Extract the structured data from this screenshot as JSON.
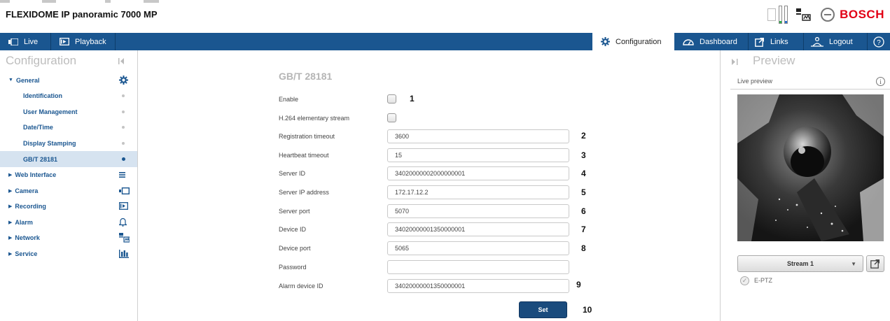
{
  "header": {
    "product_title": "FLEXIDOME IP panoramic 7000 MP",
    "brand": "BOSCH",
    "colors": {
      "brand_red": "#e20015",
      "nav_blue": "#1a5690"
    }
  },
  "nav": {
    "live": "Live",
    "playback": "Playback",
    "configuration": "Configuration",
    "dashboard": "Dashboard",
    "links": "Links",
    "logout": "Logout",
    "help_icon": "help-icon"
  },
  "sidebar": {
    "title": "Configuration",
    "general": {
      "label": "General",
      "items": [
        {
          "label": "Identification"
        },
        {
          "label": "User Management"
        },
        {
          "label": "Date/Time"
        },
        {
          "label": "Display Stamping"
        },
        {
          "label": "GB/T 28181",
          "active": true
        }
      ]
    },
    "groups": [
      {
        "label": "Web Interface",
        "icon": "list-icon"
      },
      {
        "label": "Camera",
        "icon": "camera-icon"
      },
      {
        "label": "Recording",
        "icon": "recording-icon"
      },
      {
        "label": "Alarm",
        "icon": "bell-icon"
      },
      {
        "label": "Network",
        "icon": "network-icon"
      },
      {
        "label": "Service",
        "icon": "service-icon"
      }
    ]
  },
  "form": {
    "title": "GB/T 28181",
    "fields": {
      "enable": {
        "label": "Enable",
        "callout": "1"
      },
      "h264": {
        "label": "H.264 elementary stream"
      },
      "registration_timeout": {
        "label": "Registration timeout",
        "value": "3600",
        "callout": "2"
      },
      "heartbeat_timeout": {
        "label": "Heartbeat timeout",
        "value": "15",
        "callout": "3"
      },
      "server_id": {
        "label": "Server ID",
        "value": "34020000002000000001",
        "callout": "4"
      },
      "server_ip": {
        "label": "Server IP address",
        "value": "172.17.12.2",
        "callout": "5"
      },
      "server_port": {
        "label": "Server port",
        "value": "5070",
        "callout": "6"
      },
      "device_id": {
        "label": "Device ID",
        "value": "34020000001350000001",
        "callout": "7"
      },
      "device_port": {
        "label": "Device port",
        "value": "5065",
        "callout": "8"
      },
      "password": {
        "label": "Password",
        "value": ""
      },
      "alarm_device_id": {
        "label": "Alarm device ID",
        "value": "34020000001350000001",
        "callout": "9"
      }
    },
    "set_button": {
      "label": "Set",
      "callout": "10"
    }
  },
  "preview": {
    "title": "Preview",
    "live_label": "Live preview",
    "info_glyph": "i",
    "stream": "Stream 1",
    "eptz": "E-PTZ"
  }
}
